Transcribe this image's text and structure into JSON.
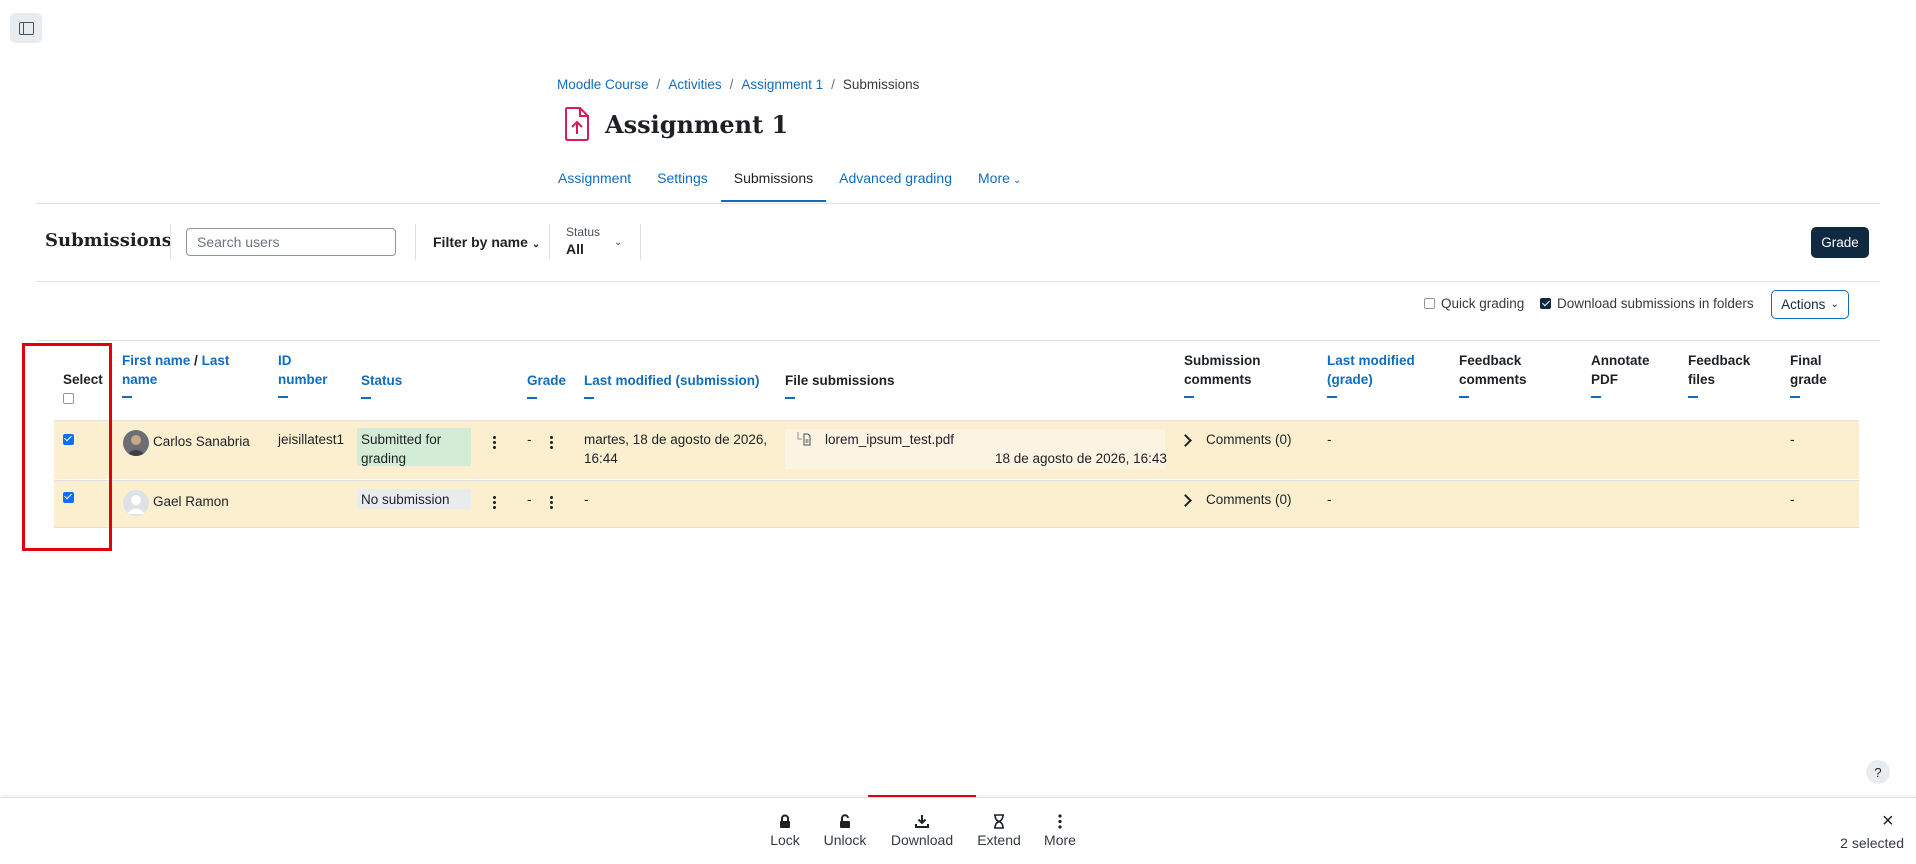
{
  "breadcrumb": [
    "Moodle Course",
    "Activities",
    "Assignment 1",
    "Submissions"
  ],
  "page": {
    "title": "Assignment 1",
    "icon": "assignment-upload-icon",
    "icon_color": "#d41c5c"
  },
  "secondary_nav": {
    "tabs": [
      "Assignment",
      "Settings",
      "Submissions",
      "Advanced grading",
      "More"
    ],
    "active": "Submissions"
  },
  "toolbar": {
    "heading": "Submissions",
    "search_placeholder": "Search users",
    "filter_by_name": "Filter by name",
    "status_label": "Status",
    "status_value": "All",
    "grade_button": "Grade"
  },
  "options": {
    "quick_grading": "Quick grading",
    "quick_grading_checked": false,
    "download_in_folders": "Download submissions in folders",
    "download_in_folders_checked": true,
    "actions_button": "Actions"
  },
  "table": {
    "headers": {
      "select": "Select",
      "first_name": "First name",
      "slash": "/",
      "last_name": "Last name",
      "id_number": "ID number",
      "status": "Status",
      "grade": "Grade",
      "last_modified_submission": "Last modified (submission)",
      "file_submissions": "File submissions",
      "submission_comments": "Submission comments",
      "last_modified_grade": "Last modified (grade)",
      "feedback_comments": "Feedback comments",
      "annotate_pdf": "Annotate PDF",
      "feedback_files": "Feedback files",
      "final_grade": "Final grade"
    },
    "rows": [
      {
        "selected": true,
        "name": "Carlos Sanabria",
        "id_number": "jeisillatest1",
        "status": "Submitted for grading",
        "grade": "-",
        "last_modified": "martes, 18 de agosto de 2026, 16:44",
        "file_name": "lorem_ipsum_test.pdf",
        "file_date": "18 de agosto de 2026, 16:43",
        "comments": "Comments (0)",
        "last_modified_grade": "-",
        "final_grade": "-"
      },
      {
        "selected": true,
        "name": "Gael Ramon",
        "id_number": "",
        "status": "No submission",
        "grade": "-",
        "last_modified": "-",
        "file_name": "",
        "file_date": "",
        "comments": "Comments (0)",
        "last_modified_grade": "-",
        "final_grade": "-"
      }
    ]
  },
  "bulk_actions": {
    "items": [
      "Lock",
      "Unlock",
      "Download",
      "Extend",
      "More"
    ],
    "selected_count": "2 selected"
  },
  "help_label": "?",
  "highlight_color": "#e0000f"
}
